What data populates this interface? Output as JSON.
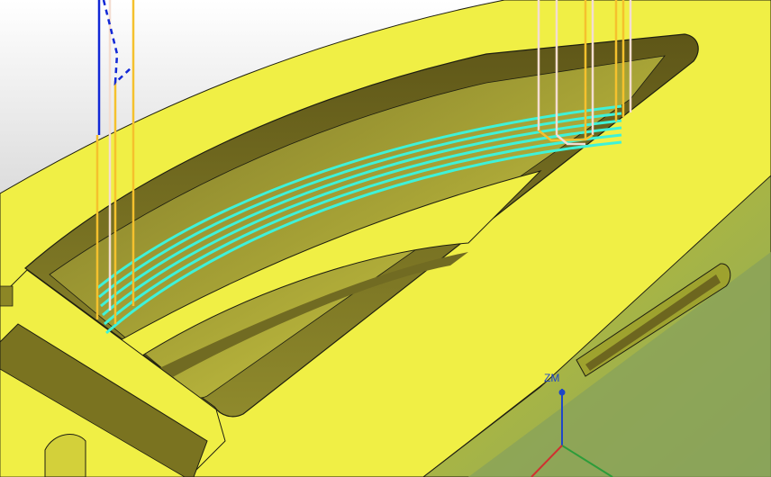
{
  "viewport": {
    "background_top": "#ffffff",
    "background_bottom": "#a9a9a9"
  },
  "model": {
    "body_color": "#f0ef45",
    "shade_color": "#b3b026",
    "dark_color": "#6d661f",
    "edge_color": "#1f1f10"
  },
  "toolpath": {
    "cut_color": "#3ff2d8",
    "feed_color": "#f5c12d",
    "approach_color": "#1228d6",
    "retract_color": "#f4ddd1",
    "pass_count": 6
  },
  "csys": {
    "label": "ZM",
    "z_color": "#1f47c8",
    "x_color": "#d03030",
    "y_color": "#2c9c3a"
  }
}
